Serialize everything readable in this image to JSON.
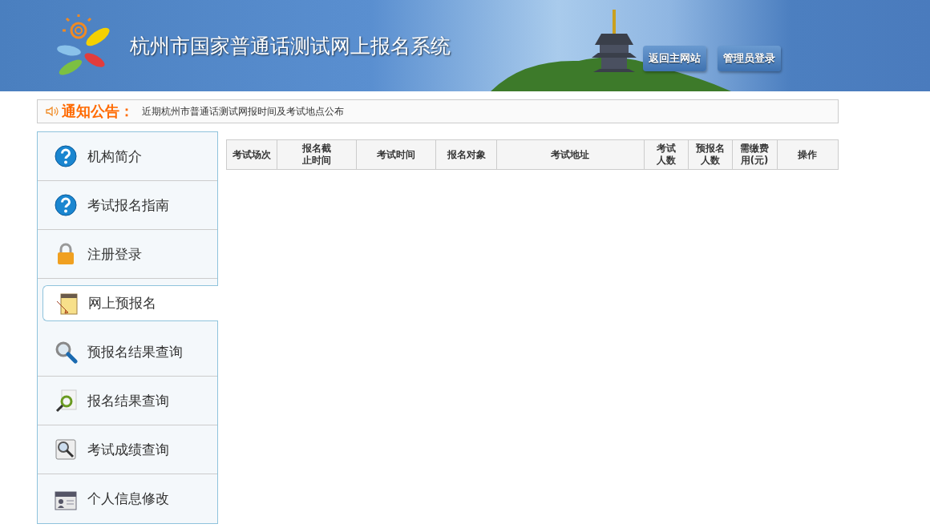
{
  "header": {
    "title": "杭州市国家普通话测试网上报名系统",
    "buttons": [
      "返回主网站",
      "管理员登录"
    ]
  },
  "notice": {
    "label": "通知公告：",
    "text": "近期杭州市普通话测试网报时间及考试地点公布"
  },
  "sidebar": {
    "items": [
      {
        "label": "机构简介",
        "kind": "help",
        "selected": false
      },
      {
        "label": "考试报名指南",
        "kind": "help",
        "selected": false
      },
      {
        "label": "注册登录",
        "kind": "lock",
        "selected": false
      },
      {
        "label": "网上预报名",
        "kind": "notepad",
        "selected": true
      },
      {
        "label": "预报名结果查询",
        "kind": "search",
        "selected": false
      },
      {
        "label": "报名结果查询",
        "kind": "docsearch",
        "selected": false
      },
      {
        "label": "考试成绩查询",
        "kind": "scoresearch",
        "selected": false
      },
      {
        "label": "个人信息修改",
        "kind": "idcard",
        "selected": false
      }
    ]
  },
  "table": {
    "columns": [
      "考试场次",
      "报名截止时间",
      "考试时间",
      "报名对象",
      "考试地址",
      "考试人数",
      "预报名人数",
      "需缴费用(元)",
      "操作"
    ]
  }
}
